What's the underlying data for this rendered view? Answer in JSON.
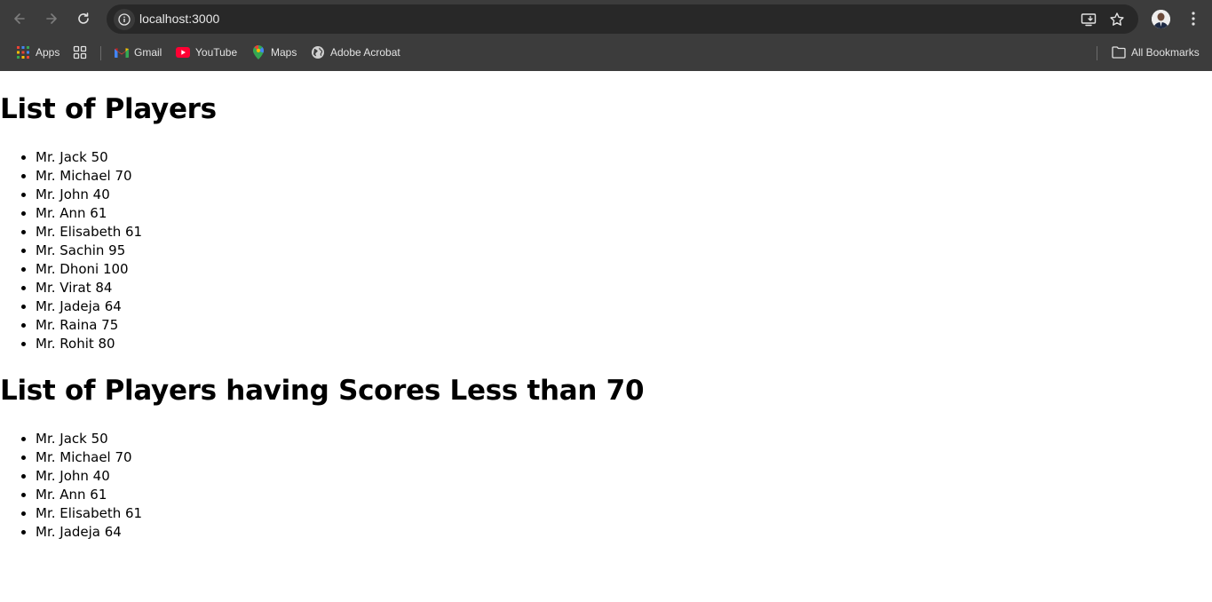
{
  "browser": {
    "url": "localhost:3000",
    "bookmarks": [
      {
        "label": "Apps",
        "icon": "apps-grid-icon"
      },
      {
        "label": "",
        "icon": "tab-groups-icon"
      },
      {
        "label": "Gmail",
        "icon": "gmail-icon"
      },
      {
        "label": "YouTube",
        "icon": "youtube-icon"
      },
      {
        "label": "Maps",
        "icon": "maps-icon"
      },
      {
        "label": "Adobe Acrobat",
        "icon": "globe-icon"
      }
    ],
    "all_bookmarks_label": "All Bookmarks"
  },
  "page": {
    "heading_all": "List of Players",
    "players_all": [
      "Mr. Jack 50",
      "Mr. Michael 70",
      "Mr. John 40",
      "Mr. Ann 61",
      "Mr. Elisabeth 61",
      "Mr. Sachin 95",
      "Mr. Dhoni 100",
      "Mr. Virat 84",
      "Mr. Jadeja 64",
      "Mr. Raina 75",
      "Mr. Rohit 80"
    ],
    "heading_filtered": "List of Players having Scores Less than 70",
    "players_filtered": [
      "Mr. Jack 50",
      "Mr. Michael 70",
      "Mr. John 40",
      "Mr. Ann 61",
      "Mr. Elisabeth 61",
      "Mr. Jadeja 64"
    ]
  },
  "colors": {
    "chrome_bg": "#3c3c3c",
    "omnibox_bg": "#282828"
  }
}
